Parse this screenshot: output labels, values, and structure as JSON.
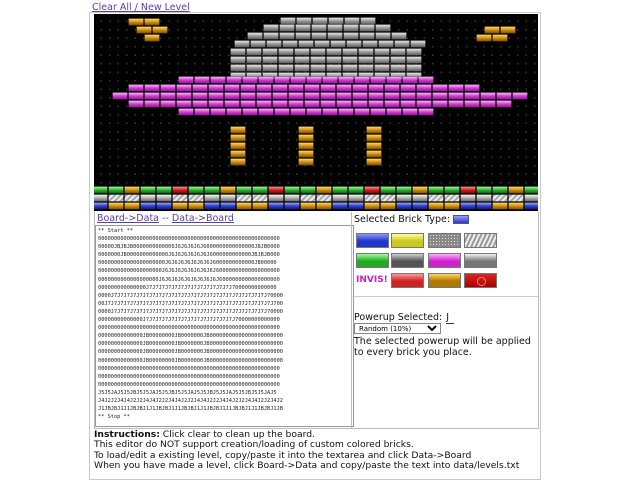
{
  "header": {
    "clear_label": "Clear All",
    "separator": " / ",
    "new_level_label": "New Level"
  },
  "toolbar": {
    "board_to_data": "Board->Data",
    "separator": " -- ",
    "data_to_board": "Data->Board"
  },
  "level_text_lines": [
    "** Start **",
    "000000000000000000000000000000000000000000000000000000000",
    "00000JBJBJB0000000000000J6J6J6J6J6000000000000000JBJB0000",
    "0000000JB0000000000000J6J6J6J6J6J6J6000000000000JBJBJB000",
    "000000000000000000000J6J6J6J6J6J6J6J6000000000000JB00000",
    "00000000000000000000J6J6J6J6J6J6J6J6J60000000000000000000",
    "0000000000000000000J6J6J6J6J6J6J6J6J6J6000000000000000000",
    "000000000000000J7J7J7J7J7J7J7J7J7J7J7J7J7J70000000000000",
    "0000J7J7J7J7J7J7J7J7J7J7J7J7J7J7J7J7J7J7J7J7J7J7J7J7J70000",
    "00J7J7J7J7J7J7J7J7J7J7J7J7J7J7J7J7J7J7J7J7J7J7J7J7J7J7J700",
    "0000J7J7J7J7J7J7J7J7J7J7J7J7J7J7J7J7J7J7J7J7J7J7J7J7J70000",
    "00000000000000J7J7J7J7J7J7J7J7J7J7J7J7J7J7J70000000000000",
    "000000000000000000000000000000000000000000000000000000000",
    "00000000000000JB00000000JB0000000JB00000000000000000000000",
    "00000000000000JB00000000JB0000000JB00000000000000000000000",
    "00000000000000JB00000000JB0000000JB00000000000000000000000",
    "00000000000000JB00000000JB0000000JB00000000000000000000000",
    "000000000000000000000000000000000000000000000000000000000",
    "000000000000000000000000000000000000000000000000000000000",
    "000000000000000000000000000000000000000000000000000000000",
    "J5J5JAJ5J5JBJ5J5JAJ5J5JBJ5J5JAJ5J5JBJ5J5JAJ5J5JBJ5J5JAJ5",
    "J4J2J2J4J4J2J2J4J4J2J2J4J4J2J2J4J4J2J2J4J4J2J2J4J4J2J2J4J2",
    "J1JBJBJ1J1JBJBJ1J1JBJBJ1J1JBJBJ1J1JBJBJ1J1JBJBJ1J1JBJBJ1JB",
    "** Stop **"
  ],
  "selected_type_label": "Selected Brick Type:",
  "palette": [
    {
      "name": "blue-brick-button",
      "fill": "#2233cc",
      "hi": "#8c94ff"
    },
    {
      "name": "yellow-brick-button",
      "fill": "#c8c820",
      "hi": "#ffff9a"
    },
    {
      "name": "granite-brick-button",
      "fill": "#888888",
      "hi": "#dddddd",
      "pattern": "speckle"
    },
    {
      "name": "striped-brick-button",
      "fill": "#999999",
      "hi": "#eeeeee",
      "pattern": "stripe"
    },
    {
      "name": "green-brick-button",
      "fill": "#22aa22",
      "hi": "#9dff9d"
    },
    {
      "name": "gray-brick-button",
      "fill": "#555555",
      "hi": "#cfcfcf"
    },
    {
      "name": "magenta-brick-button",
      "fill": "#cc22cc",
      "hi": "#ffb0ff"
    },
    {
      "name": "silver-brick-button",
      "fill": "#777777",
      "hi": "#f2f2f2"
    },
    {
      "name": "invisible-brick-button",
      "label": "INVIS!"
    },
    {
      "name": "red-brick-button",
      "fill": "#cc2222",
      "hi": "#ff9a9a"
    },
    {
      "name": "gold-brick-button",
      "fill": "#b07800",
      "hi": "#ffd760"
    },
    {
      "name": "bomb-brick-button",
      "fill": "#aa0000",
      "hi": "#dd2222",
      "pattern": "bomb"
    }
  ],
  "invis_label": "INVIS!",
  "powerup_label": "Powerup Selected:",
  "powerup_value": "J",
  "powerup_option": "Random (10%)",
  "powerup_note": "The selected powerup will be applied to every brick you place.",
  "instructions": {
    "title": "Instructions:",
    "line1": " Click clear to clean up the board.",
    "line2": "This editor do NOT support creation/loading of custom colored bricks.",
    "line3": "To load/edit a existing level, copy/paste it into the textarea and click Data->Board",
    "line4": "When you have made a level, click Board->Data and copy/paste the text into data/levels.txt"
  },
  "colors": {
    "link": "#5a3fa0",
    "board_bg": "#000000",
    "gray_brick": "#8a8a8a",
    "magenta_brick": "#d040d0",
    "gold_brick": "#d89a10",
    "bomb_brick": "#c41a1a",
    "green_brick": "#30b030",
    "blue_brick": "#3040c8"
  }
}
